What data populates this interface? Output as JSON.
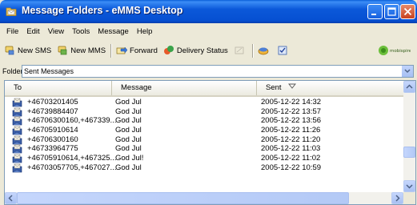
{
  "window": {
    "title": "Message Folders - eMMS Desktop"
  },
  "menu": [
    "File",
    "Edit",
    "View",
    "Tools",
    "Message",
    "Help"
  ],
  "toolbar": {
    "new_sms": "New SMS",
    "new_mms": "New MMS",
    "forward": "Forward",
    "delivery_status": "Delivery Status",
    "logo_text": "mobispire"
  },
  "folder": {
    "label": "Folder",
    "value": "Sent Messages"
  },
  "columns": {
    "to": "To",
    "message": "Message",
    "sent": "Sent"
  },
  "rows": [
    {
      "to": "+46703201405",
      "message": "God Jul",
      "sent": "2005-12-22 14:32"
    },
    {
      "to": "+46739884407",
      "message": "God Jul",
      "sent": "2005-12-22 13:57"
    },
    {
      "to": "+46706300160,+467339...",
      "message": "God Jul",
      "sent": "2005-12-22 13:56"
    },
    {
      "to": "+46705910614",
      "message": "God Jul",
      "sent": "2005-12-22 11:26"
    },
    {
      "to": "+46706300160",
      "message": "God Jul",
      "sent": "2005-12-22 11:20"
    },
    {
      "to": "+46733964775",
      "message": "God Jul",
      "sent": "2005-12-22 11:03"
    },
    {
      "to": "+46705910614,+467325...",
      "message": "God Jul!",
      "sent": "2005-12-22 11:02"
    },
    {
      "to": "+46703057705,+467027...",
      "message": "God Jul",
      "sent": "2005-12-22 10:59"
    }
  ]
}
